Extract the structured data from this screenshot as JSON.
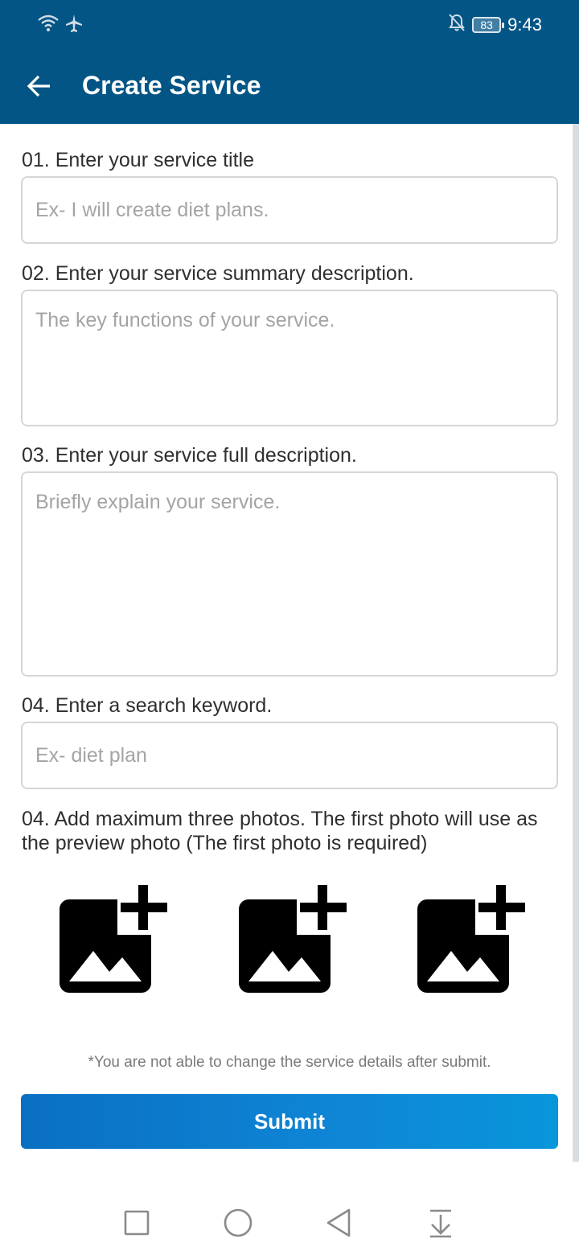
{
  "status_bar": {
    "time": "9:43",
    "battery": "83",
    "icons": [
      "wifi-icon",
      "airplane-icon",
      "bell-off-icon",
      "battery-icon"
    ]
  },
  "app_bar": {
    "title": "Create Service",
    "back_icon": "arrow-left-icon",
    "color": "#035585"
  },
  "form": {
    "title_field": {
      "label": "01. Enter your service title",
      "placeholder": "Ex- I will create diet plans.",
      "value": ""
    },
    "summary_field": {
      "label": "02. Enter your service summary description.",
      "placeholder": "The key functions of your service.",
      "value": ""
    },
    "full_description_field": {
      "label": "03. Enter your service full description.",
      "placeholder": "Briefly explain your service.",
      "value": ""
    },
    "keyword_field": {
      "label": "04. Enter a search keyword.",
      "placeholder": "Ex- diet plan",
      "value": ""
    },
    "photos": {
      "label": "04. Add maximum three photos. The first photo will use as the preview photo (The first photo is required)",
      "slots": [
        {
          "icon": "add-photo-icon"
        },
        {
          "icon": "add-photo-icon"
        },
        {
          "icon": "add-photo-icon"
        }
      ]
    },
    "notice": "*You are not able to change the service details after submit.",
    "submit_label": "Submit",
    "accent_color": "#0a7fd0"
  },
  "nav_bar": {
    "icons": [
      "square-icon",
      "circle-icon",
      "triangle-back-icon",
      "download-icon"
    ]
  }
}
